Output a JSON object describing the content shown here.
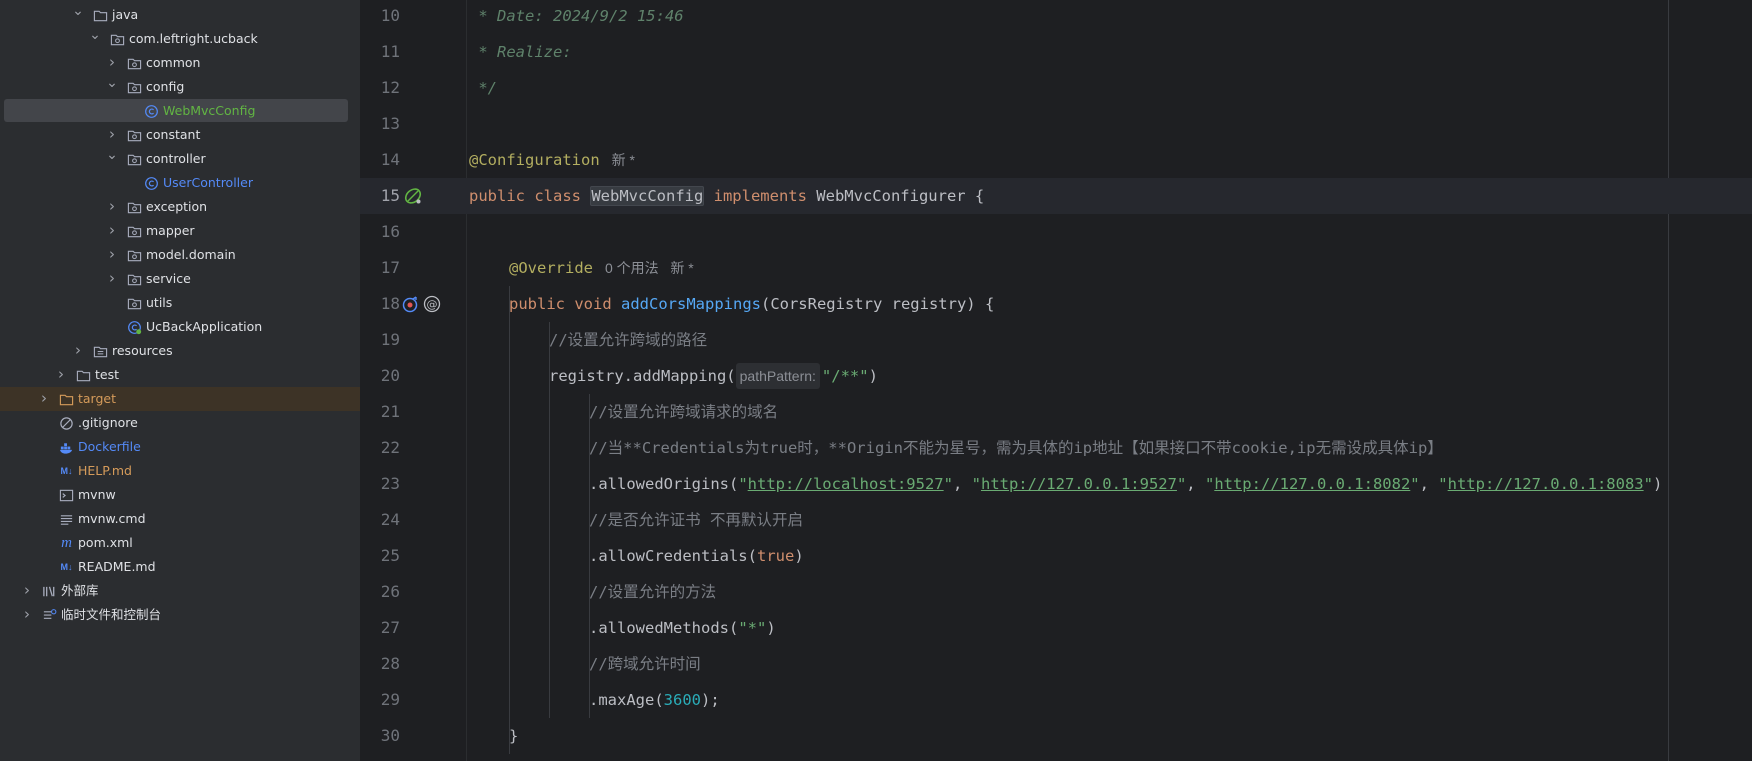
{
  "project_tree": {
    "items": [
      {
        "label": "java",
        "icon": "folder-icon",
        "chevron": "expanded",
        "depth": 3,
        "color": "#dfe1e5"
      },
      {
        "label": "com.leftright.ucback",
        "icon": "package-icon",
        "chevron": "expanded",
        "depth": 4,
        "color": "#dfe1e5"
      },
      {
        "label": "common",
        "icon": "package-icon",
        "chevron": "collapsed",
        "depth": 5,
        "color": "#dfe1e5"
      },
      {
        "label": "config",
        "icon": "package-icon",
        "chevron": "expanded",
        "depth": 5,
        "color": "#dfe1e5"
      },
      {
        "label": "WebMvcConfig",
        "icon": "class-icon",
        "chevron": "none",
        "depth": 6,
        "color": "#62b543",
        "selected": true
      },
      {
        "label": "constant",
        "icon": "package-icon",
        "chevron": "collapsed",
        "depth": 5,
        "color": "#dfe1e5"
      },
      {
        "label": "controller",
        "icon": "package-icon",
        "chevron": "expanded",
        "depth": 5,
        "color": "#dfe1e5"
      },
      {
        "label": "UserController",
        "icon": "class-icon",
        "chevron": "none",
        "depth": 6,
        "color": "#548af7"
      },
      {
        "label": "exception",
        "icon": "package-icon",
        "chevron": "collapsed",
        "depth": 5,
        "color": "#dfe1e5"
      },
      {
        "label": "mapper",
        "icon": "package-icon",
        "chevron": "collapsed",
        "depth": 5,
        "color": "#dfe1e5"
      },
      {
        "label": "model.domain",
        "icon": "package-icon",
        "chevron": "collapsed",
        "depth": 5,
        "color": "#dfe1e5"
      },
      {
        "label": "service",
        "icon": "package-icon",
        "chevron": "collapsed",
        "depth": 5,
        "color": "#dfe1e5"
      },
      {
        "label": "utils",
        "icon": "package-icon",
        "chevron": "none",
        "depth": 5,
        "color": "#dfe1e5"
      },
      {
        "label": "UcBackApplication",
        "icon": "spring-class-icon",
        "chevron": "none",
        "depth": 5,
        "color": "#dfe1e5"
      },
      {
        "label": "resources",
        "icon": "resources-folder-icon",
        "chevron": "collapsed",
        "depth": 3,
        "color": "#dfe1e5"
      },
      {
        "label": "test",
        "icon": "folder-icon",
        "chevron": "collapsed",
        "depth": 2,
        "color": "#dfe1e5"
      },
      {
        "label": "target",
        "icon": "excluded-folder-icon",
        "chevron": "collapsed",
        "depth": 1,
        "color": "#d59b5a",
        "highlight": true
      },
      {
        "label": ".gitignore",
        "icon": "ignore-file-icon",
        "chevron": "none",
        "depth": 1,
        "color": "#dfe1e5"
      },
      {
        "label": "Dockerfile",
        "icon": "docker-icon",
        "chevron": "none",
        "depth": 1,
        "color": "#548af7"
      },
      {
        "label": "HELP.md",
        "icon": "markdown-icon",
        "chevron": "none",
        "depth": 1,
        "color": "#d59b5a"
      },
      {
        "label": "mvnw",
        "icon": "terminal-file-icon",
        "chevron": "none",
        "depth": 1,
        "color": "#dfe1e5"
      },
      {
        "label": "mvnw.cmd",
        "icon": "text-file-icon",
        "chevron": "none",
        "depth": 1,
        "color": "#dfe1e5"
      },
      {
        "label": "pom.xml",
        "icon": "maven-icon",
        "chevron": "none",
        "depth": 1,
        "color": "#dfe1e5"
      },
      {
        "label": "README.md",
        "icon": "markdown-icon",
        "chevron": "none",
        "depth": 1,
        "color": "#dfe1e5"
      },
      {
        "label": "外部库",
        "icon": "library-icon",
        "chevron": "collapsed",
        "depth": 0,
        "color": "#dfe1e5"
      },
      {
        "label": "临时文件和控制台",
        "icon": "scratches-icon",
        "chevron": "collapsed",
        "depth": 0,
        "color": "#dfe1e5"
      }
    ]
  },
  "editor": {
    "current_line": 15,
    "lines": [
      {
        "num": "10",
        "indent": 0,
        "tokens": [
          {
            "t": " * Date: 2024/9/2 15:46",
            "c": "doc"
          }
        ]
      },
      {
        "num": "11",
        "indent": 0,
        "tokens": [
          {
            "t": " * Realize:",
            "c": "doc"
          }
        ]
      },
      {
        "num": "12",
        "indent": 0,
        "tokens": [
          {
            "t": " */",
            "c": "doc"
          }
        ]
      },
      {
        "num": "13",
        "indent": 0,
        "tokens": []
      },
      {
        "num": "14",
        "indent": 0,
        "tokens": [
          {
            "t": "@Configuration",
            "c": "ann"
          },
          {
            "t": "新 *",
            "c": "hint"
          }
        ]
      },
      {
        "num": "15",
        "indent": 0,
        "tokens": [
          {
            "t": "public ",
            "c": "kw"
          },
          {
            "t": "class ",
            "c": "kw"
          },
          {
            "t": "WebMvcConfig",
            "c": "cls word-hl"
          },
          {
            "t": " implements ",
            "c": "kw"
          },
          {
            "t": "WebMvcConfigurer {",
            "c": "cls"
          }
        ]
      },
      {
        "num": "16",
        "indent": 0,
        "tokens": []
      },
      {
        "num": "17",
        "indent": 1,
        "tokens": [
          {
            "t": "@Override",
            "c": "ann"
          },
          {
            "t": "0 个用法   新 *",
            "c": "hint"
          }
        ]
      },
      {
        "num": "18",
        "indent": 1,
        "tokens": [
          {
            "t": "public ",
            "c": "kw"
          },
          {
            "t": "void ",
            "c": "kw"
          },
          {
            "t": "addCorsMappings",
            "c": "fn"
          },
          {
            "t": "(CorsRegistry registry) {",
            "c": "cls"
          }
        ]
      },
      {
        "num": "19",
        "indent": 2,
        "tokens": [
          {
            "t": "//设置允许跨域的路径",
            "c": "cmt"
          }
        ]
      },
      {
        "num": "20",
        "indent": 2,
        "tokens": [
          {
            "t": "registry.addMapping(",
            "c": "cls"
          },
          {
            "t": "pathPattern:",
            "c": "param-hint"
          },
          {
            "t": "\"/**\"",
            "c": "str"
          },
          {
            "t": ")",
            "c": "cls"
          }
        ]
      },
      {
        "num": "21",
        "indent": 3,
        "tokens": [
          {
            "t": "//设置允许跨域请求的域名",
            "c": "cmt"
          }
        ]
      },
      {
        "num": "22",
        "indent": 3,
        "tokens": [
          {
            "t": "//当**Credentials为true时，**Origin不能为星号，需为具体的ip地址【如果接口不带cookie,ip无需设成具体ip】",
            "c": "cmt"
          }
        ]
      },
      {
        "num": "23",
        "indent": 3,
        "tokens": [
          {
            "t": ".allowedOrigins(",
            "c": "cls"
          },
          {
            "t": "\"",
            "c": "str"
          },
          {
            "t": "http://localhost:9527",
            "c": "url"
          },
          {
            "t": "\"",
            "c": "str"
          },
          {
            "t": ", ",
            "c": "cls"
          },
          {
            "t": "\"",
            "c": "str"
          },
          {
            "t": "http://127.0.0.1:9527",
            "c": "url"
          },
          {
            "t": "\"",
            "c": "str"
          },
          {
            "t": ", ",
            "c": "cls"
          },
          {
            "t": "\"",
            "c": "str"
          },
          {
            "t": "http://127.0.0.1:8082",
            "c": "url"
          },
          {
            "t": "\"",
            "c": "str"
          },
          {
            "t": ", ",
            "c": "cls"
          },
          {
            "t": "\"",
            "c": "str"
          },
          {
            "t": "http://127.0.0.1:8083",
            "c": "url"
          },
          {
            "t": "\"",
            "c": "str"
          },
          {
            "t": ")",
            "c": "cls"
          }
        ]
      },
      {
        "num": "24",
        "indent": 3,
        "tokens": [
          {
            "t": "//是否允许证书 不再默认开启",
            "c": "cmt"
          }
        ]
      },
      {
        "num": "25",
        "indent": 3,
        "tokens": [
          {
            "t": ".allowCredentials(",
            "c": "cls"
          },
          {
            "t": "true",
            "c": "kw"
          },
          {
            "t": ")",
            "c": "cls"
          }
        ]
      },
      {
        "num": "26",
        "indent": 3,
        "tokens": [
          {
            "t": "//设置允许的方法",
            "c": "cmt"
          }
        ]
      },
      {
        "num": "27",
        "indent": 3,
        "tokens": [
          {
            "t": ".allowedMethods(",
            "c": "cls"
          },
          {
            "t": "\"*\"",
            "c": "str"
          },
          {
            "t": ")",
            "c": "cls"
          }
        ]
      },
      {
        "num": "28",
        "indent": 3,
        "tokens": [
          {
            "t": "//跨域允许时间",
            "c": "cmt"
          }
        ]
      },
      {
        "num": "29",
        "indent": 3,
        "tokens": [
          {
            "t": ".maxAge(",
            "c": "cls"
          },
          {
            "t": "3600",
            "c": "num"
          },
          {
            "t": ");",
            "c": "cls"
          }
        ]
      },
      {
        "num": "30",
        "indent": 1,
        "tokens": [
          {
            "t": "}",
            "c": "cls"
          }
        ]
      }
    ],
    "gutter_icons": [
      {
        "line": "15",
        "name": "spring-bean-icon"
      },
      {
        "line": "18",
        "name": "implements-method-icon"
      },
      {
        "line": "18",
        "name": "override-at-icon"
      }
    ]
  },
  "colors": {
    "sidebar_bg": "#2b2d30",
    "editor_bg": "#1e1f22",
    "keyword": "#cf8e6d",
    "annotation": "#b3ae60",
    "method": "#56a8f5",
    "string": "#6aab73",
    "number": "#2aacb8",
    "comment": "#7a7e85",
    "doc_comment": "#5f826b"
  }
}
